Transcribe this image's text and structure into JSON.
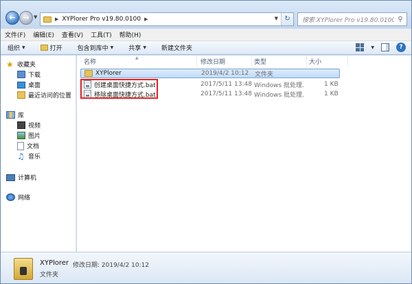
{
  "address": {
    "path": "XYPlorer Pro v19.80.0100"
  },
  "search": {
    "placeholder": "搜索 XYPlorer Pro v19.80.0100"
  },
  "menubar": [
    "文件(F)",
    "编辑(E)",
    "查看(V)",
    "工具(T)",
    "帮助(H)"
  ],
  "toolbar": {
    "organize": "组织",
    "open": "打开",
    "include_in_library": "包含到库中",
    "share": "共享",
    "new_folder": "新建文件夹"
  },
  "sidebar": {
    "favorites": {
      "label": "收藏夹",
      "items": [
        "下载",
        "桌面",
        "最近访问的位置"
      ]
    },
    "libraries": {
      "label": "库",
      "items": [
        "视频",
        "图片",
        "文档",
        "音乐"
      ]
    },
    "computer": "计算机",
    "network": "网络"
  },
  "columns": {
    "name": "名称",
    "date": "修改日期",
    "type": "类型",
    "size": "大小"
  },
  "files": [
    {
      "name": "XYPlorer",
      "date": "2019/4/2 10:12",
      "type": "文件夹",
      "size": "",
      "icon": "folder-icon"
    },
    {
      "name": "创建桌面快捷方式.bat",
      "date": "2017/5/11 13:48",
      "type": "Windows 批处理...",
      "size": "1 KB",
      "icon": "batch-file-icon"
    },
    {
      "name": "移除桌面快捷方式.bat",
      "date": "2017/5/11 13:48",
      "type": "Windows 批处理...",
      "size": "1 KB",
      "icon": "batch-file-icon"
    }
  ],
  "details": {
    "name": "XYPlorer",
    "meta": "修改日期: 2019/4/2 10:12",
    "type": "文件夹"
  },
  "colors": {
    "highlight": "#e32222",
    "selection": "#c1dbfa",
    "accent": "#2f73c0"
  }
}
